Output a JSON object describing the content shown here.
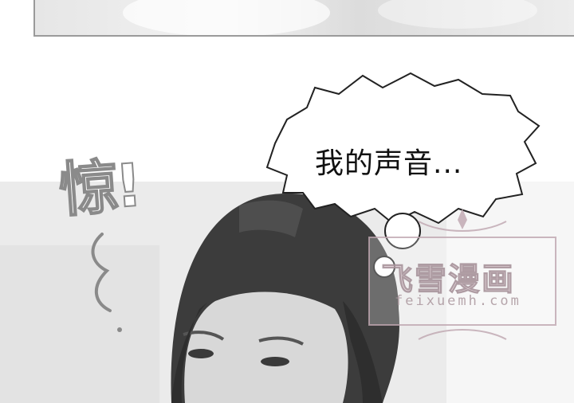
{
  "speech_bubble": {
    "text": "我的声音..."
  },
  "sound_effect": {
    "text": "惊!"
  },
  "watermark": {
    "title": "飞雪漫画",
    "url": "feixuemh.com"
  },
  "colors": {
    "background": "#ffffff",
    "panel_border": "#9a9a9a",
    "ink": "#111111",
    "watermark": "#d7bec6"
  }
}
